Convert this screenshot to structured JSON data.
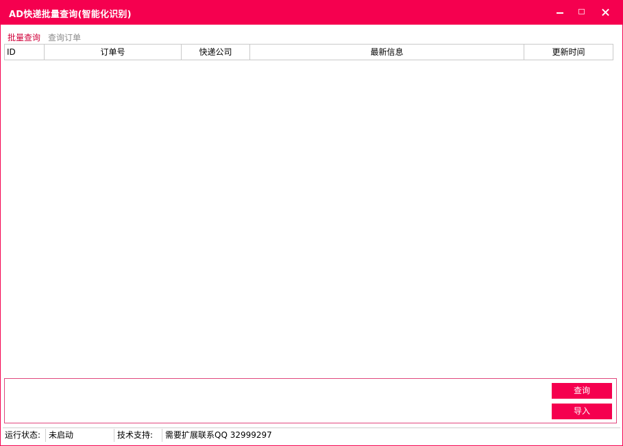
{
  "window": {
    "title": "AD快递批量查询(智能化识别)",
    "accent_color": "#f5004f",
    "controls": [
      "minimize-icon",
      "maximize-icon",
      "close-icon"
    ]
  },
  "tabs": [
    {
      "label": "批量查询",
      "active": true
    },
    {
      "label": "查询订单",
      "active": false
    }
  ],
  "table": {
    "columns": [
      "ID",
      "订单号",
      "快递公司",
      "最新信息",
      "更新时间"
    ],
    "rows": []
  },
  "actions": {
    "query_label": "查询",
    "import_label": "导入"
  },
  "status": {
    "state_label": "运行状态:",
    "state_value": "未启动",
    "support_label": "技术支持:",
    "support_value": "需要扩展联系QQ 32999297"
  }
}
